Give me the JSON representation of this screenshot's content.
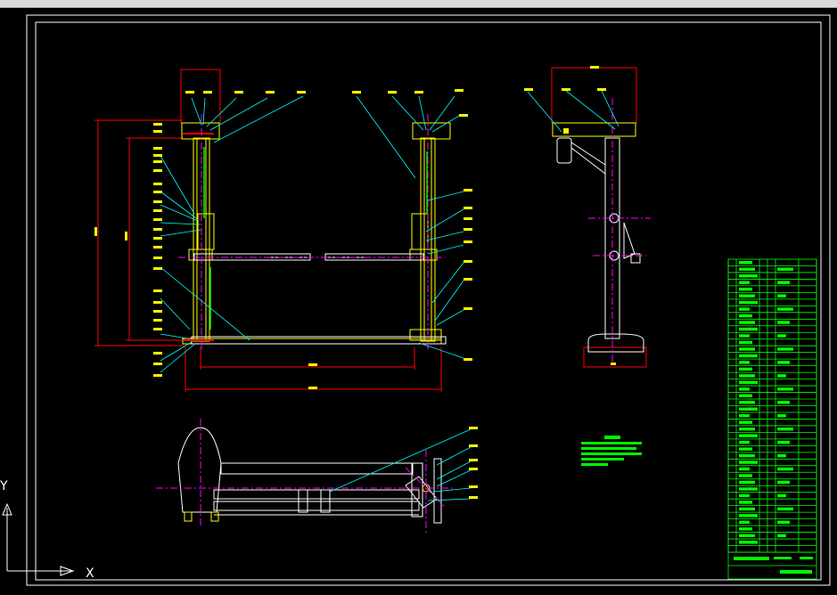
{
  "ucs": {
    "x_label": "X",
    "y_label": "Y"
  },
  "colors": {
    "background": "#000000",
    "frame": "#ffffff",
    "part": "#ffff00",
    "dim": "#ff0000",
    "leader": "#00ffff",
    "center": "#ff00ff",
    "table": "#00ff00"
  }
}
